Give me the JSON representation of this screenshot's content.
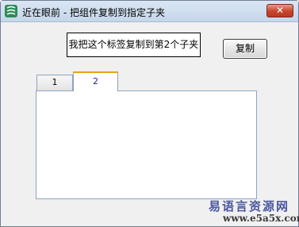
{
  "window": {
    "title": "近在眼前 - 把组件复制到指定子夹",
    "close_label": "✕"
  },
  "main": {
    "label_text": "我把这个标签复制到第2个子夹",
    "copy_button_label": "复制"
  },
  "tabs": [
    {
      "label": "1",
      "selected": false
    },
    {
      "label": "2",
      "selected": true
    }
  ],
  "watermark": {
    "site_name": "易语言资源网",
    "url": "www.e5a5x.com"
  },
  "colors": {
    "title_bar": "#c5d6ea",
    "close_button": "#c8432b",
    "selected_tab_accent": "#e8a317",
    "watermark": "#4a57a0"
  },
  "icons": {
    "app": "app-logo-icon",
    "close": "close-icon"
  }
}
